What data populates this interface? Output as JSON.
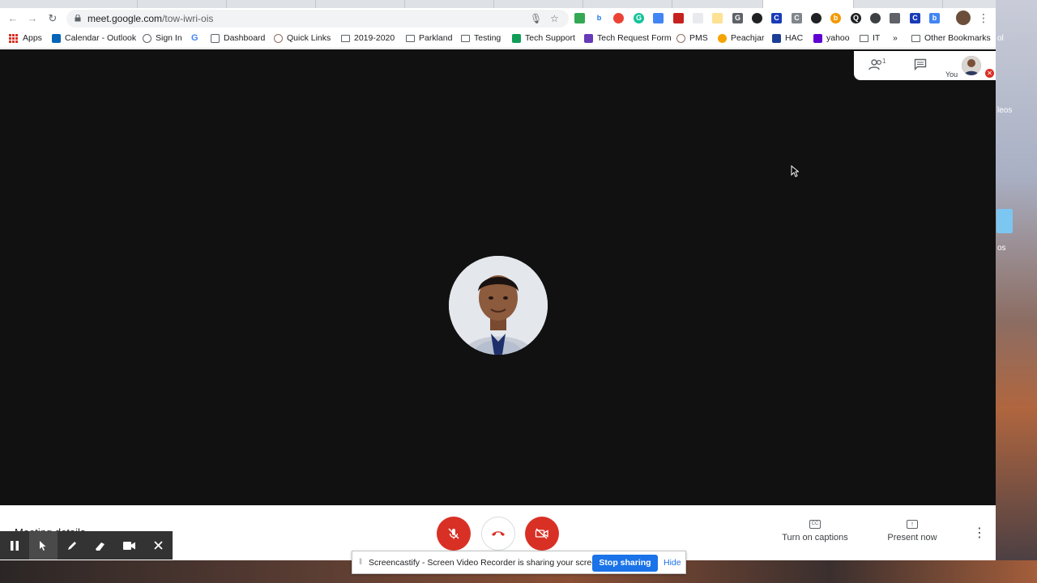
{
  "browser": {
    "url_host": "meet.google.com",
    "url_path": "/tow-iwri-ois"
  },
  "bookmarks": [
    {
      "label": "Apps",
      "icon": "apps-icon"
    },
    {
      "label": "Calendar - Outlook",
      "icon": "outlook-icon"
    },
    {
      "label": "Sign In",
      "icon": "globe-icon"
    },
    {
      "label": "",
      "icon": "google-icon"
    },
    {
      "label": "Dashboard",
      "icon": "dashboard-icon"
    },
    {
      "label": "Quick Links",
      "icon": "globe-icon"
    },
    {
      "label": "2019-2020",
      "icon": "folder-icon"
    },
    {
      "label": "Parkland",
      "icon": "folder-icon"
    },
    {
      "label": "Testing",
      "icon": "folder-icon"
    },
    {
      "label": "Tech Support",
      "icon": "sheets-icon"
    },
    {
      "label": "Tech Request Form",
      "icon": "forms-icon"
    },
    {
      "label": "PMS",
      "icon": "globe-icon"
    },
    {
      "label": "Peachjar",
      "icon": "peach-icon"
    },
    {
      "label": "HAC",
      "icon": "hac-icon"
    },
    {
      "label": "yahoo",
      "icon": "yahoo-icon"
    },
    {
      "label": "IT",
      "icon": "folder-icon"
    },
    {
      "label": "»",
      "icon": ""
    },
    {
      "label": "Other Bookmarks",
      "icon": "folder-icon"
    }
  ],
  "meet": {
    "panel_you_label": "You",
    "participants_count": "1",
    "meeting_details_label": "Meeting details",
    "captions_label": "Turn on captions",
    "present_label": "Present now",
    "captions_icon_text": "CC"
  },
  "share_bar": {
    "message": "Screencastify - Screen Video Recorder is sharing your screen.",
    "stop_label": "Stop sharing",
    "hide_label": "Hide"
  },
  "desktop": {
    "label_top": "ol",
    "label_mid": "leos",
    "label_low": "os"
  },
  "colors": {
    "meet_red": "#d93025",
    "link_blue": "#1a73e8",
    "meet_bg": "#111111"
  }
}
